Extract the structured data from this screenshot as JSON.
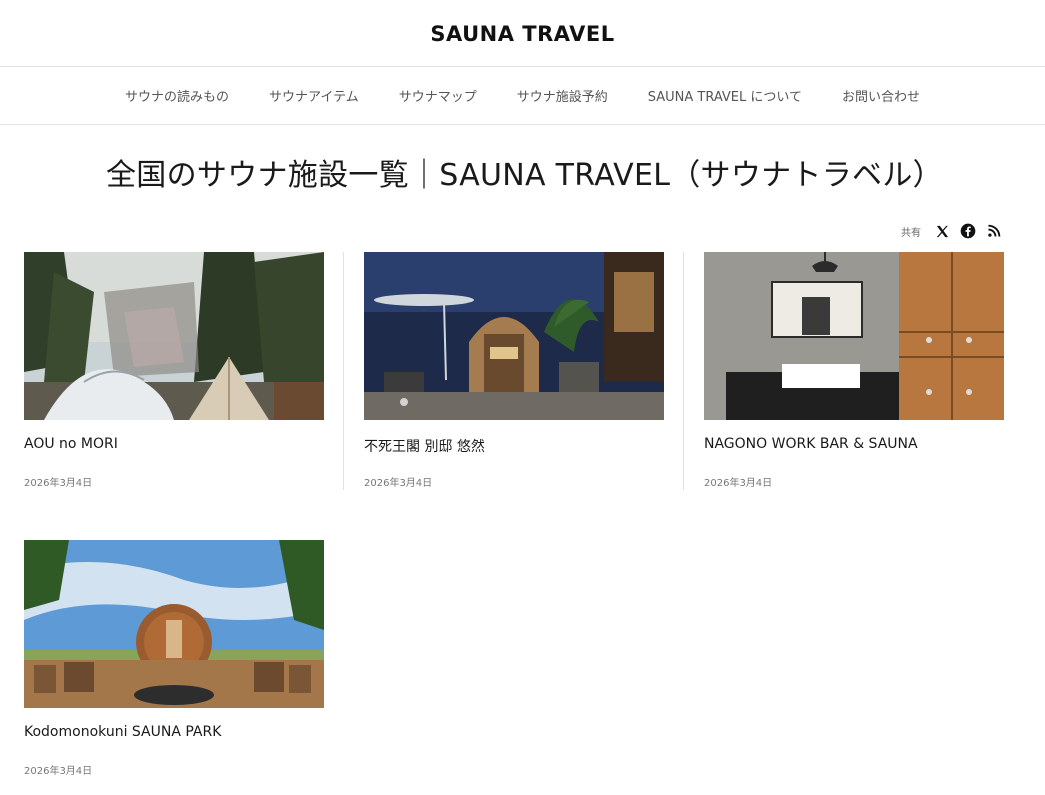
{
  "site": {
    "title": "SAUNA TRAVEL"
  },
  "nav": {
    "items": [
      {
        "label": "サウナの読みもの"
      },
      {
        "label": "サウナアイテム"
      },
      {
        "label": "サウナマップ"
      },
      {
        "label": "サウナ施設予約"
      },
      {
        "label": "SAUNA TRAVEL について"
      },
      {
        "label": "お問い合わせ"
      }
    ]
  },
  "page": {
    "title": "全国のサウナ施設一覧｜SAUNA TRAVEL（サウナトラベル）"
  },
  "share": {
    "label": "共有",
    "icons": [
      "x-icon",
      "facebook-icon",
      "rss-icon"
    ]
  },
  "posts": [
    {
      "title": "AOU no MORI",
      "date": "2026年3月4日",
      "image": "forest-tent-dome"
    },
    {
      "title": "不死王閣 別邸 悠然",
      "date": "2026年3月4日",
      "image": "night-barrel-sauna"
    },
    {
      "title": "NAGONO WORK BAR & SAUNA",
      "date": "2026年3月4日",
      "image": "locker-room-sink"
    },
    {
      "title": "Kodomonokuni SAUNA PARK",
      "date": "2026年3月4日",
      "image": "barrel-sauna-sky"
    }
  ],
  "colors": {
    "text": "#1a1a1a",
    "muted": "#555555",
    "border": "#e2e2e2"
  }
}
